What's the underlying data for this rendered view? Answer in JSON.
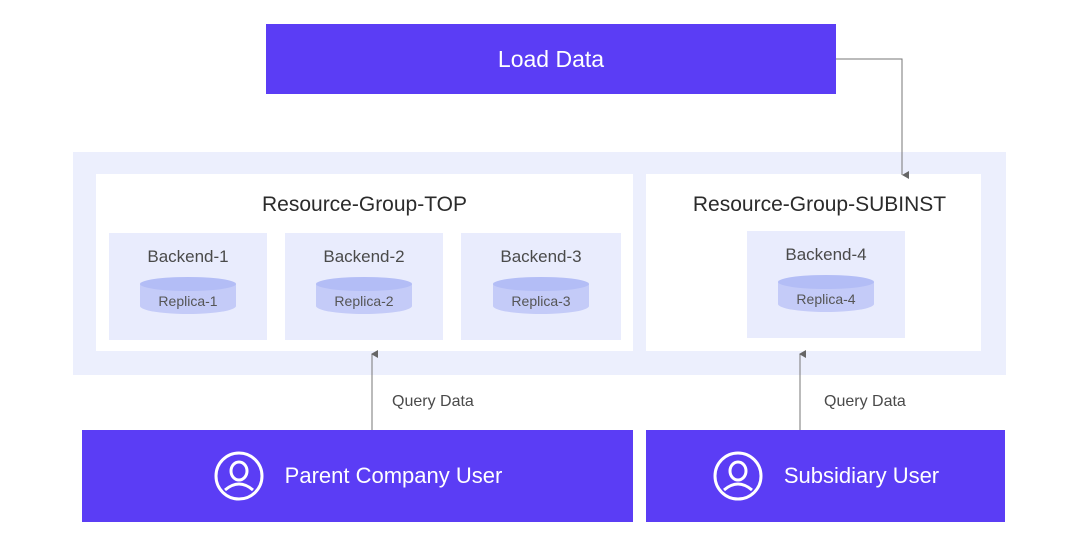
{
  "load_data": {
    "label": "Load Data"
  },
  "groups": {
    "top": {
      "title": "Resource-Group-TOP",
      "backends": [
        {
          "label": "Backend-1",
          "replica": "Replica-1"
        },
        {
          "label": "Backend-2",
          "replica": "Replica-2"
        },
        {
          "label": "Backend-3",
          "replica": "Replica-3"
        }
      ]
    },
    "subinst": {
      "title": "Resource-Group-SUBINST",
      "backends": [
        {
          "label": "Backend-4",
          "replica": "Replica-4"
        }
      ]
    }
  },
  "users": {
    "parent": {
      "label": "Parent Company User",
      "icon": "user-icon"
    },
    "subsidiary": {
      "label": "Subsidiary User",
      "icon": "user-icon"
    }
  },
  "queries": {
    "left": "Query Data",
    "right": "Query Data"
  },
  "colors": {
    "accent": "#5b3df5",
    "panel": "#eceffd",
    "backend": "#e9ecfd",
    "replica": "#c4cbf8"
  }
}
